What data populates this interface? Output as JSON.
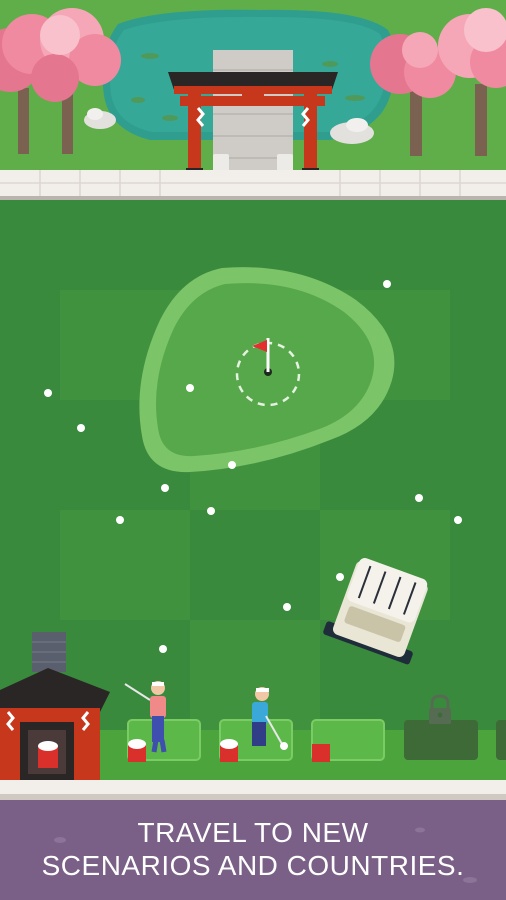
{
  "promo": {
    "line1": "TRAVEL TO NEW",
    "line2": "SCENARIOS AND COUNTRIES."
  },
  "colors": {
    "grass_dark": "#3a8a3e",
    "grass_light": "#43983f",
    "green_ring": "#7bc468",
    "green_fill": "#56a84a",
    "pond": "#2f9e8f",
    "torii_red": "#c6371c",
    "torii_black": "#2a2626",
    "cherry_pink": "#f08aa0",
    "path_white": "#f2eeea",
    "banner_bg": "#7a5f86"
  },
  "icons": {
    "lock": "lock-icon",
    "flag": "flag-icon"
  },
  "tee_slots": 5,
  "locked_slots": 2
}
